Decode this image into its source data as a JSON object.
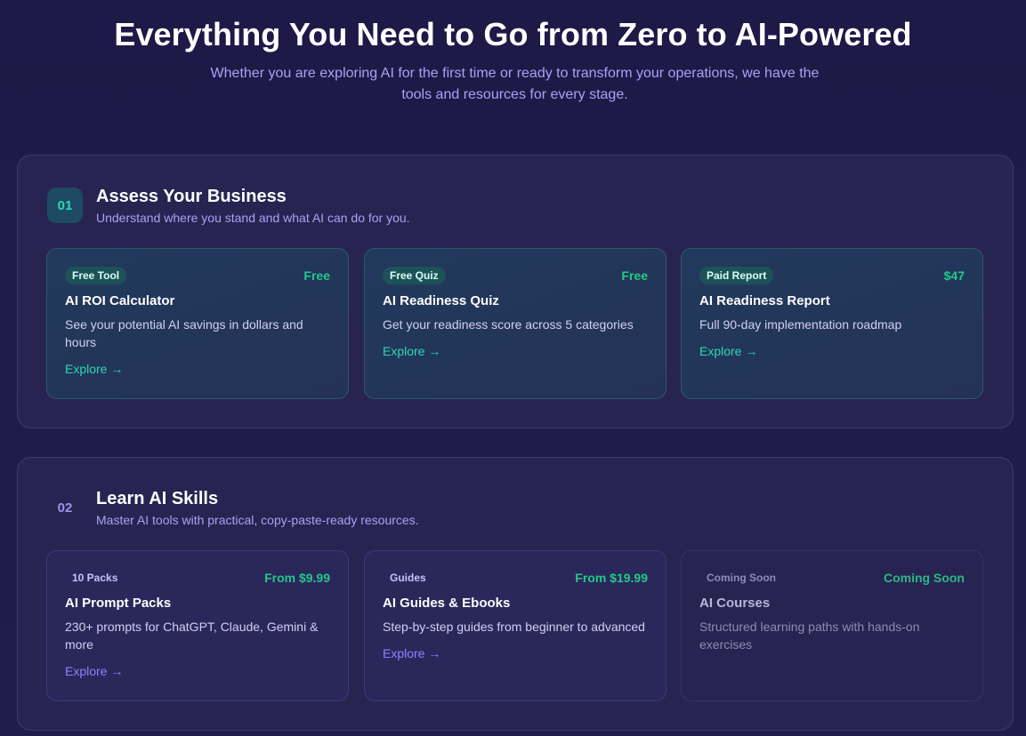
{
  "hero": {
    "title": "Everything You Need to Go from Zero to AI-Powered",
    "subtitle": "Whether you are exploring AI for the first time or ready to transform your operations, we have the tools and resources for every stage."
  },
  "sections": [
    {
      "number": "01",
      "title": "Assess Your Business",
      "description": "Understand where you stand and what AI can do for you.",
      "cards": [
        {
          "tag": "Free Tool",
          "price": "Free",
          "title": "AI ROI Calculator",
          "description": "See your potential AI savings in dollars and hours",
          "link": "Explore →"
        },
        {
          "tag": "Free Quiz",
          "price": "Free",
          "title": "AI Readiness Quiz",
          "description": "Get your readiness score across 5 categories",
          "link": "Explore →"
        },
        {
          "tag": "Paid Report",
          "price": "$47",
          "title": "AI Readiness Report",
          "description": "Full 90-day implementation roadmap",
          "link": "Explore →"
        }
      ]
    },
    {
      "number": "02",
      "title": "Learn AI Skills",
      "description": "Master AI tools with practical, copy-paste-ready resources.",
      "cards": [
        {
          "tag": "10 Packs",
          "price": "From $9.99",
          "title": "AI Prompt Packs",
          "description": "230+ prompts for ChatGPT, Claude, Gemini & more",
          "link": "Explore →"
        },
        {
          "tag": "Guides",
          "price": "From $19.99",
          "title": "AI Guides & Ebooks",
          "description": "Step-by-step guides from beginner to advanced",
          "link": "Explore →"
        },
        {
          "tag": "Coming Soon",
          "price": "Coming Soon",
          "title": "AI Courses",
          "description": "Structured learning paths with hands-on exercises"
        }
      ]
    }
  ],
  "colors": {
    "background": "#1f1a47",
    "accent_teal": "#2fd6b4",
    "accent_violet": "#8a84ff",
    "price_green": "#22c98a"
  }
}
